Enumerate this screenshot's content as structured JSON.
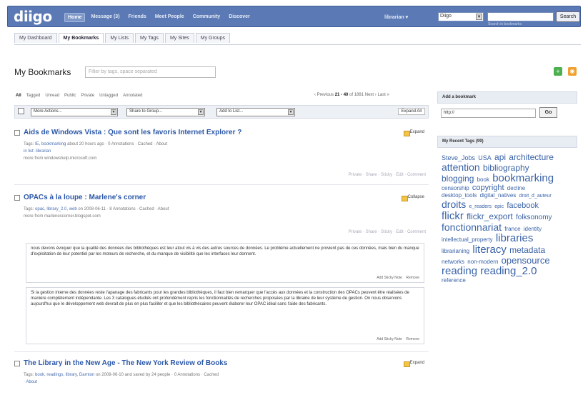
{
  "header": {
    "logo": "diigo",
    "nav": [
      "Home",
      "Message (3)",
      "Friends",
      "Meet People",
      "Community",
      "Discover"
    ],
    "user": "librarian ▾",
    "scope": "Diigo",
    "search_button": "Search",
    "search_hint": "Search in bookmarks"
  },
  "subnav": [
    "My Dashboard",
    "My Bookmarks",
    "My Lists",
    "My Tags",
    "My Sites",
    "My Groups"
  ],
  "page": {
    "title": "My Bookmarks",
    "filter_placeholder": "Filter by tags, space separated"
  },
  "filters": [
    "All",
    "Tagged",
    "Unread",
    "Public",
    "Private",
    "Untagged",
    "Annotated"
  ],
  "pager": {
    "prefix": "‹ Previous",
    "range": "21 - 40",
    "of_label": "of",
    "total": "1891",
    "next": "Next ›",
    "last": "Last »"
  },
  "toolbar": {
    "more_actions": "More Actions...",
    "share_group": "Share to Group...",
    "add_list": "Add to List...",
    "expand_all": "Expand All"
  },
  "bookmarks": [
    {
      "title": "Aids de Windows Vista : Que sont les favoris Internet Explorer ?",
      "toggle": "Expand",
      "tags_label": "Tags:",
      "tags": "IE, bookmarking",
      "meta": "about 20 hours ago · 0 Annotations · Cached · About",
      "extra": "in list: librarian",
      "more_from": "more from windowshelp.microsoft.com",
      "actions": "Private · Share · Sticky · Edit · Comment"
    },
    {
      "title": "OPACs à la loupe : Marlene's corner",
      "toggle": "Collapse",
      "tags_label": "Tags:",
      "tags": "opac, library_2.0, web",
      "meta": "on 2008-06-11 · 8 Annotations · Cached · About",
      "more_from": "more from marlenescorner.blogspot.com",
      "actions": "Private · Share · Sticky · Edit · Comment"
    },
    {
      "title": "The Library in the New Age - The New York Review of Books",
      "toggle": "Expand",
      "tags_label": "Tags:",
      "tags": "book, readings, library, Darnton",
      "meta": "on 2008-06-10 and saved by 24 people · 0 Annotations · Cached",
      "extra": "· About"
    }
  ],
  "notes": [
    {
      "text": "nous devons évoquer que la qualité des données des bibliothèques est leur atout vis à vis des autres sources de données. Le problème actuellement ne provient pas de ces données, mais bien du manque d'exploitation de leur potentiel par les moteurs de recherche, et du manque de visibilité que les interfaces leur donnent.",
      "add_note": "Add Sticky Note",
      "remove": "Remove"
    },
    {
      "text": "Si la gestion interne des données reste l'apanage des fabricants pour les grandes bibliothèques, il faut bien remarquer que l'accès aux données et la construction des OPACs peuvent être réalisées de manière complètement indépendante. Les 3 catalogues étudiés ont profondément repris les fonctionnalités de recherches proposées par la librairie de leur système de gestion. On nous observons aujourd'hui que le développement web devrait de plus en plus faciliter et que les bibliothécaires peuvent élaborer leur OPAC idéal sans l'aide des fabricants.",
      "add_note": "Add Sticky Note",
      "remove": "Remove"
    }
  ],
  "right_panel": {
    "add_header": "Add a bookmark",
    "url_value": "http://",
    "go": "Go",
    "tags_header": "My Recent Tags (99)"
  },
  "tag_cloud": [
    {
      "t": "Steve_Jobs",
      "s": 9
    },
    {
      "t": "USA",
      "s": 9
    },
    {
      "t": "api",
      "s": 12
    },
    {
      "t": "architecture",
      "s": 12
    },
    {
      "t": "attention",
      "s": 14
    },
    {
      "t": "bibliography",
      "s": 12
    },
    {
      "t": "blogging",
      "s": 12
    },
    {
      "t": "book",
      "s": 8
    },
    {
      "t": "bookmarking",
      "s": 15
    },
    {
      "t": "censorship",
      "s": 8
    },
    {
      "t": "copyright",
      "s": 11
    },
    {
      "t": "decline",
      "s": 8
    },
    {
      "t": "desktop_tools",
      "s": 8
    },
    {
      "t": "digital_natives",
      "s": 8
    },
    {
      "t": "droit_d_auteur",
      "s": 7
    },
    {
      "t": "droits",
      "s": 14
    },
    {
      "t": "e_readers",
      "s": 7
    },
    {
      "t": "epic",
      "s": 7
    },
    {
      "t": "facebook",
      "s": 11
    },
    {
      "t": "flickr",
      "s": 15
    },
    {
      "t": "flickr_export",
      "s": 12
    },
    {
      "t": "folksonomy",
      "s": 10
    },
    {
      "t": "fonctionnariat",
      "s": 14
    },
    {
      "t": "france",
      "s": 8
    },
    {
      "t": "identity",
      "s": 8
    },
    {
      "t": "intellectual_property",
      "s": 8
    },
    {
      "t": "libraries",
      "s": 15
    },
    {
      "t": "librarianing",
      "s": 8
    },
    {
      "t": "literacy",
      "s": 15
    },
    {
      "t": "metadata",
      "s": 12
    },
    {
      "t": "networks",
      "s": 8
    },
    {
      "t": "non-modern",
      "s": 8
    },
    {
      "t": "opensource",
      "s": 13
    },
    {
      "t": "reading",
      "s": 15
    },
    {
      "t": "reading_2.0",
      "s": 15
    },
    {
      "t": "reference",
      "s": 8
    }
  ],
  "colors": {
    "header": "#5b79b4",
    "link": "#2c58a8",
    "tag": "#3a63a8"
  }
}
